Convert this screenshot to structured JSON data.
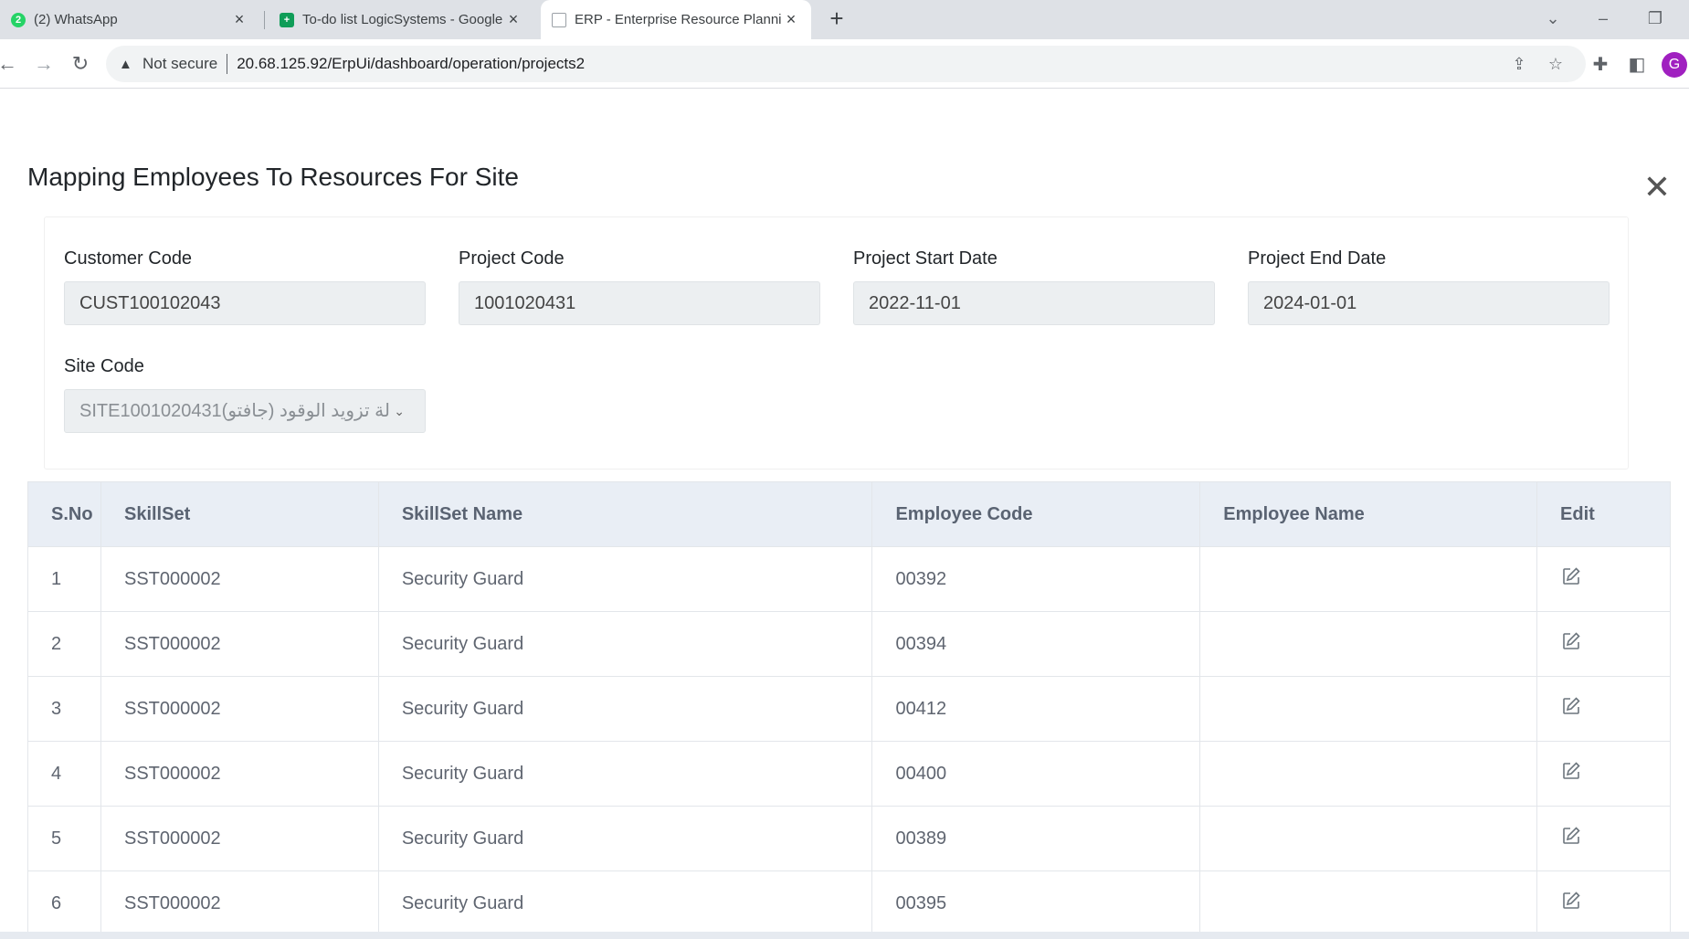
{
  "browser": {
    "tabs": [
      {
        "title": "(2) WhatsApp",
        "badge": "2",
        "icon": "whatsapp-icon",
        "color": "#25d366"
      },
      {
        "title": "To-do list LogicSystems - Google",
        "icon": "sheets-icon",
        "color": "#0f9d58"
      },
      {
        "title": "ERP - Enterprise Resource Plannin",
        "icon": "page-icon",
        "color": "#5f6368"
      }
    ],
    "address": {
      "security_label": "Not secure",
      "url": "20.68.125.92/ErpUi/dashboard/operation/projects2"
    },
    "profile_initial": "G"
  },
  "modal": {
    "title": "Mapping Employees To Resources For Site",
    "close_glyph": "✕"
  },
  "form": {
    "customer_code": {
      "label": "Customer Code",
      "value": "CUST100102043"
    },
    "project_code": {
      "label": "Project Code",
      "value": "1001020431"
    },
    "project_start_date": {
      "label": "Project Start Date",
      "value": "2022-11-01"
    },
    "project_end_date": {
      "label": "Project End Date",
      "value": "2024-01-01"
    },
    "site_code": {
      "label": "Site Code",
      "value": "SITE1001020431(لة تزويد الوقود (جافتو"
    }
  },
  "table": {
    "headers": {
      "sno": "S.No",
      "skillset": "SkillSet",
      "skillset_name": "SkillSet Name",
      "employee_code": "Employee Code",
      "employee_name": "Employee Name",
      "edit": "Edit"
    },
    "rows": [
      {
        "sno": "1",
        "skillset": "SST000002",
        "skillset_name": "Security Guard",
        "employee_code": "00392",
        "employee_name": ""
      },
      {
        "sno": "2",
        "skillset": "SST000002",
        "skillset_name": "Security Guard",
        "employee_code": "00394",
        "employee_name": ""
      },
      {
        "sno": "3",
        "skillset": "SST000002",
        "skillset_name": "Security Guard",
        "employee_code": "00412",
        "employee_name": ""
      },
      {
        "sno": "4",
        "skillset": "SST000002",
        "skillset_name": "Security Guard",
        "employee_code": "00400",
        "employee_name": ""
      },
      {
        "sno": "5",
        "skillset": "SST000002",
        "skillset_name": "Security Guard",
        "employee_code": "00389",
        "employee_name": ""
      },
      {
        "sno": "6",
        "skillset": "SST000002",
        "skillset_name": "Security Guard",
        "employee_code": "00395",
        "employee_name": ""
      }
    ]
  }
}
